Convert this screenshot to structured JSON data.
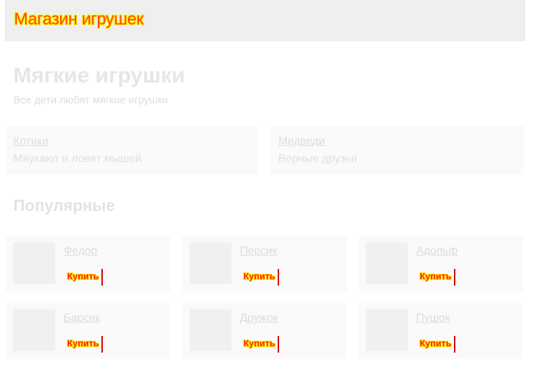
{
  "header": {
    "title": "Магазин игрушек"
  },
  "main": {
    "title": "Мягкие игрушки",
    "subtitle": "Все дети любят мягкие игрушки"
  },
  "categories": [
    {
      "name": "Котики",
      "description": "Мяукают и ловят мышей"
    },
    {
      "name": "Медведи",
      "description": "Верные друзья"
    }
  ],
  "popular": {
    "title": "Популярные",
    "products": [
      {
        "name": "Федор",
        "buy_label": "Купить"
      },
      {
        "name": "Персик",
        "buy_label": "Купить"
      },
      {
        "name": "Адольф",
        "buy_label": "Купить"
      },
      {
        "name": "Барсик",
        "buy_label": "Купить"
      },
      {
        "name": "Дружок",
        "buy_label": "Купить"
      },
      {
        "name": "Пушок",
        "buy_label": "Купить"
      }
    ]
  }
}
